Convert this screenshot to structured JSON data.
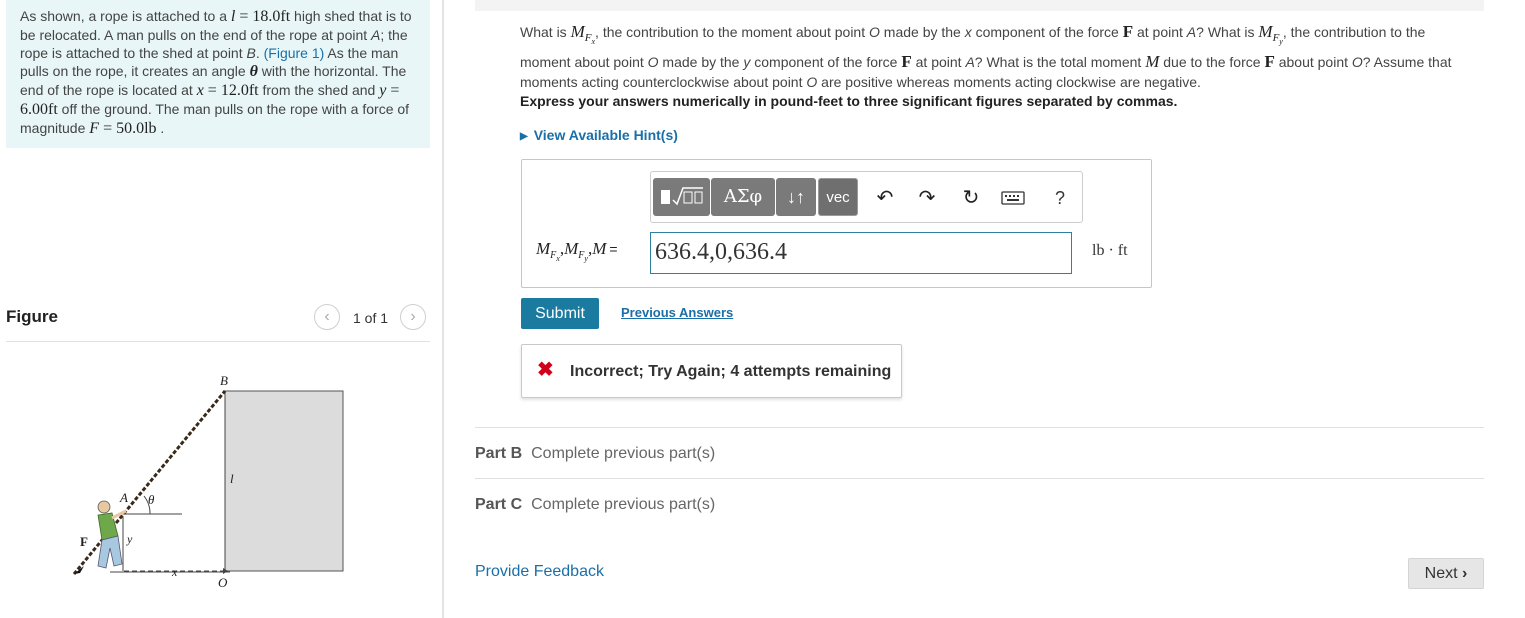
{
  "problem": {
    "t1": "As shown, a rope is attached to a ",
    "l_sym": "l",
    "l_eq": " = 18.0",
    "l_unit": "ft",
    "t2": " high shed that is to be relocated. A man pulls on the end of the rope at point ",
    "pA": "A",
    "t3": "; the rope is attached to the shed at point ",
    "pB": "B",
    "t4": ". ",
    "fig_link": "(Figure 1)",
    "t5": " As the man pulls on the rope, it creates an angle ",
    "theta": "θ",
    "t6": " with the horizontal. The end of the rope is located at ",
    "x_sym": "x",
    "x_eq": " = 12.0",
    "x_unit": "ft",
    "t7": " from the shed and ",
    "y_sym": "y",
    "y_eq": " = 6.00",
    "y_unit": "ft",
    "t8": " off the ground. The man pulls on the rope with a force of magnitude ",
    "F_sym": "F",
    "F_eq": " = 50.0",
    "F_unit": "lb",
    "t9": " ."
  },
  "figure": {
    "title": "Figure",
    "counter": "1 of 1",
    "prev_icon": "chevron-left-icon",
    "next_icon": "chevron-right-icon",
    "labels": {
      "B": "B",
      "A": "A",
      "theta": "θ",
      "F": "F",
      "y": "y",
      "x": "x",
      "l": "l",
      "O": "O"
    }
  },
  "question": {
    "q1": "What is ",
    "M": "M",
    "Fx_sub": "F",
    "Fx_subsub": "x",
    "q2": ", the contribution to the moment about point ",
    "O": "O",
    "q3": " made by the ",
    "x": "x",
    "q4": " component of the force ",
    "F": "F",
    "q5": " at point ",
    "A": "A",
    "q6": "? What is ",
    "Fy_subsub": "y",
    "q7": ", the contribution to the moment about point ",
    "q8": " made by the ",
    "y": "y",
    "q9": " component of the force ",
    "q10": "? What is the total moment ",
    "q11": " due to the force ",
    "q12": " about point ",
    "q13": "? Assume that moments acting counterclockwise about point ",
    "q14": " are positive whereas moments acting clockwise are negative."
  },
  "instructions": "Express your answers numerically in pound-feet to three significant figures separated by commas.",
  "hint": {
    "label": "View Available Hint(s)",
    "icon": "triangle-right-icon"
  },
  "toolbar": {
    "template_icon": "template-sqrt-icon",
    "greek_label": "ΑΣφ",
    "arrows_label": "↓↑",
    "vec_label": "vec",
    "undo_icon": "undo-icon",
    "redo_icon": "redo-icon",
    "reset_icon": "reset-icon",
    "keyboard_icon": "keyboard-icon",
    "help_label": "?"
  },
  "answer": {
    "label_M": "M",
    "label_F": "F",
    "label_x": "x",
    "label_y": "y",
    "label_eq": "=",
    "value": "636.4,0,636.4",
    "unit": "lb · ft"
  },
  "submit_label": "Submit",
  "previous_answers_label": "Previous Answers",
  "feedback": {
    "icon": "x-mark-icon",
    "text": "Incorrect; Try Again; 4 attempts remaining"
  },
  "parts": [
    {
      "label": "Part B",
      "status": "Complete previous part(s)"
    },
    {
      "label": "Part C",
      "status": "Complete previous part(s)"
    }
  ],
  "provide_feedback_label": "Provide Feedback",
  "next_label": "Next",
  "colors": {
    "accent": "#1a7aa0",
    "link": "#1a6fa8",
    "error": "#d0021b",
    "problem_bg": "#e8f6f8"
  }
}
